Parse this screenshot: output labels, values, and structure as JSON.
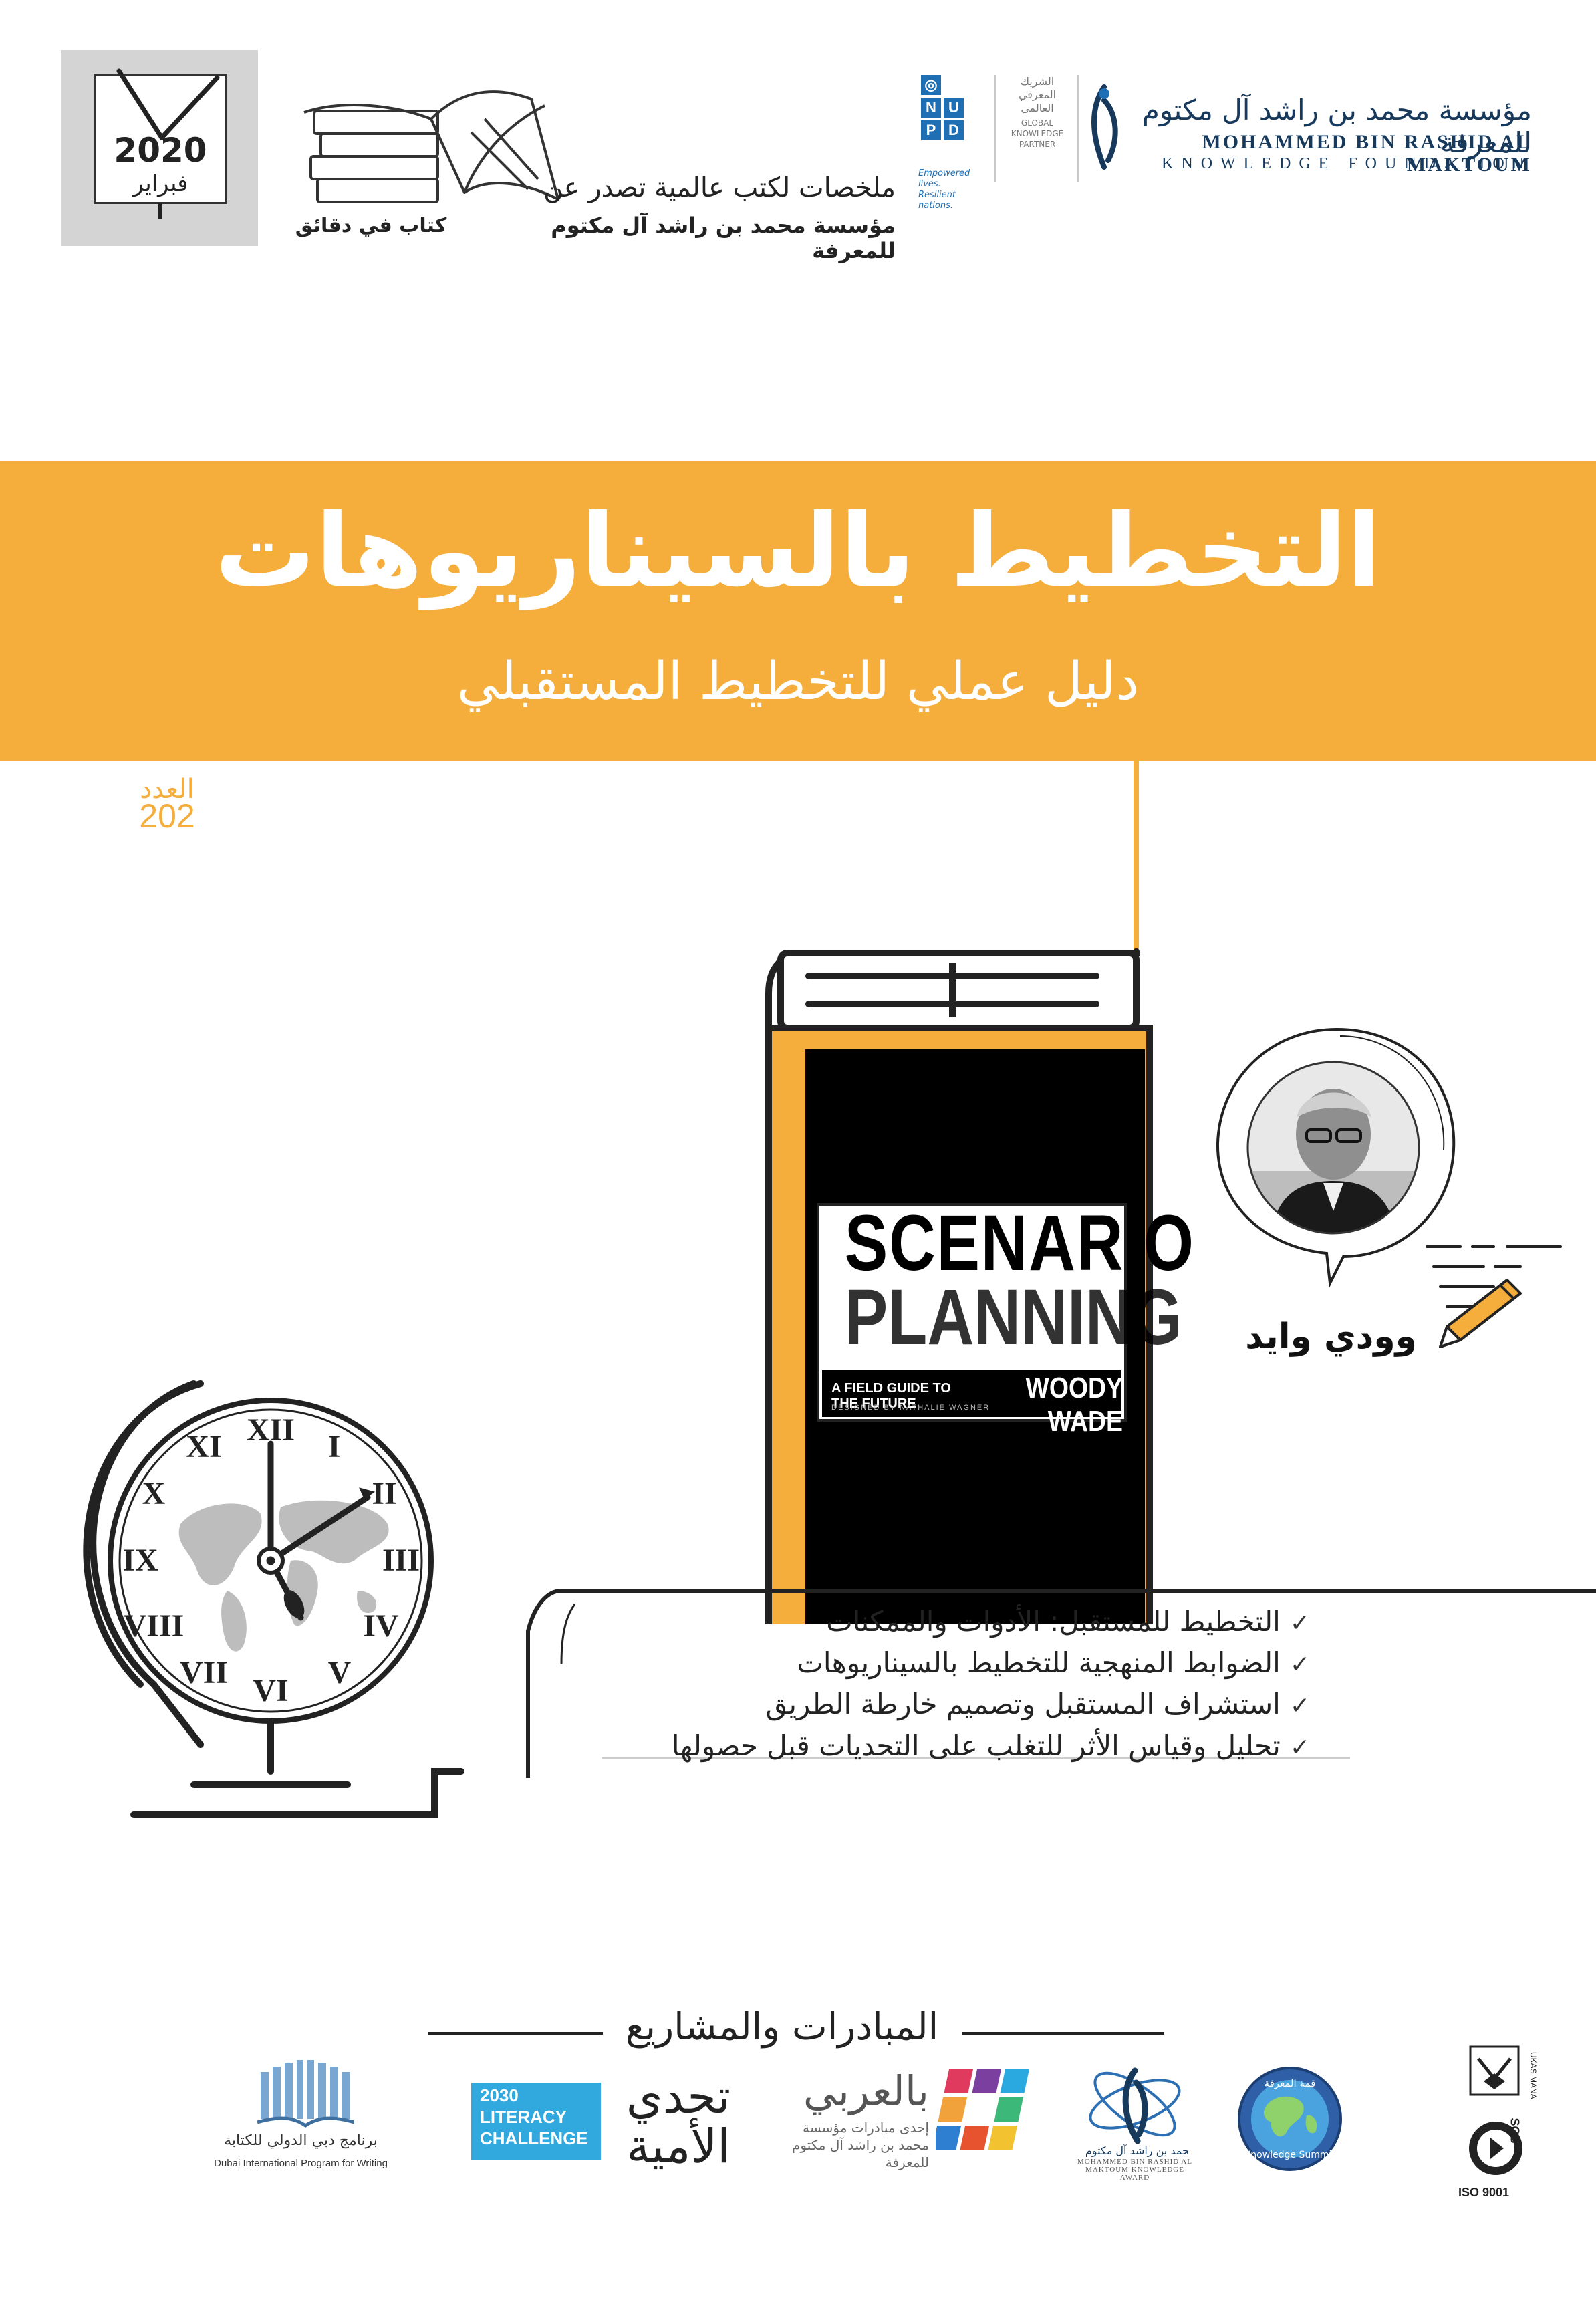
{
  "header": {
    "calendar": {
      "year": "2020",
      "month": "فبراير"
    },
    "books_caption": "كتاب في دقائق",
    "summaries_line1": "ملخصات لكتب عالمية تصدر عن",
    "summaries_line2": "مؤسسة محمد بن راشد آل مكتوم للمعرفة",
    "undp": {
      "letters": [
        "U",
        "N",
        "D",
        "P"
      ],
      "tagline_1": "Empowered lives.",
      "tagline_2": "Resilient nations."
    },
    "partner": {
      "ar_1": "الشريك",
      "ar_2": "المعرفي",
      "ar_3": "العالمي",
      "en_1": "GLOBAL",
      "en_2": "KNOWLEDGE",
      "en_3": "PARTNER"
    },
    "foundation": {
      "name_ar": "مؤسسة محمد بن راشد آل مكتوم للمعرفة",
      "name_en_1": "MOHAMMED BIN RASHID AL MAKTOUM",
      "name_en_2": "KNOWLEDGE FOUNDATION"
    }
  },
  "title": "التخطيط بالسيناريوهات",
  "subtitle": "دليل عملي للتخطيط المستقبلي",
  "issue": {
    "label": "العدد",
    "number": "202"
  },
  "book_cover": {
    "line1": "SCENARIO",
    "line2": "PLANNING",
    "subtitle": "A FIELD GUIDE TO THE FUTURE",
    "author": "WOODY WADE",
    "credit": "DESIGNED BY NATHALIE WAGNER"
  },
  "author_name": "وودي وايد",
  "topics": [
    "التخطيط للمستقبل: الأدوات والممكنات",
    "الضوابط المنهجية للتخطيط بالسيناريوهات",
    "استشراف المستقبل وتصميم خارطة الطريق",
    "تحليل وقياس الأثر للتغلب على التحديات قبل حصولها"
  ],
  "check_mark": "✓",
  "footer": {
    "initiatives_title": "المبادرات والمشاريع",
    "dipw_ar": "برنامج دبي الدولي للكتابة",
    "dipw_en": "Dubai International Program for Writing",
    "literacy": {
      "year": "2030",
      "line1": "LITERACY",
      "line2": "CHALLENGE"
    },
    "literacy_ar": "تحدي الأمية",
    "bilarabi": "بالعربي",
    "bilarabi_sub_1": "إحدى مبادرات مؤسسة",
    "bilarabi_sub_2": "محمد بن راشد آل مكتوم للمعرفة",
    "mbr_en": "MOHAMMED BIN RASHID AL MAKTOUM KNOWLEDGE AWARD",
    "knowledge_summit_ar": "قمة المعرفة",
    "knowledge_summit": "Knowledge Summit",
    "sgs": "SGS",
    "iso": "ISO 9001"
  },
  "colors": {
    "accent": "#f5ad3c",
    "dark": "#222222",
    "ink_blue": "#17395c",
    "undp_blue": "#1f6fb5"
  }
}
